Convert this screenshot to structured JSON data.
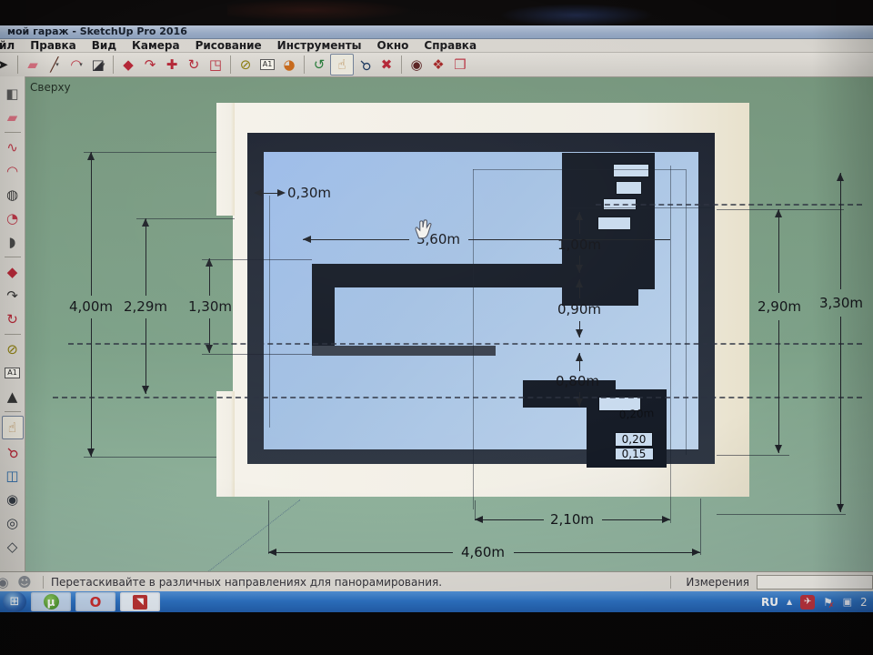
{
  "window": {
    "title": "мой гараж - SketchUp Pro 2016"
  },
  "menu_bar": {
    "items": [
      "Файл",
      "Правка",
      "Вид",
      "Камера",
      "Рисование",
      "Инструменты",
      "Окно",
      "Справка"
    ]
  },
  "toolbar": {
    "tools": [
      {
        "name": "select-tool",
        "glyph": "➤",
        "color": "#1d1d1d"
      },
      {
        "type": "sep"
      },
      {
        "name": "eraser-tool",
        "glyph": "▰",
        "color": "#d96b7d"
      },
      {
        "name": "line-tool",
        "glyph": "╱",
        "color": "#5a2d20",
        "dd": true
      },
      {
        "name": "arc-tool",
        "glyph": "◠",
        "color": "#c03344",
        "dd": true
      },
      {
        "name": "rectangle-tool",
        "glyph": "◪",
        "color": "#2d2d33",
        "dd": true
      },
      {
        "type": "sep"
      },
      {
        "name": "push-pull-tool",
        "glyph": "◆",
        "color": "#bb2233"
      },
      {
        "name": "follow-me-tool",
        "glyph": "↷",
        "color": "#bb2233"
      },
      {
        "name": "move-tool",
        "glyph": "✚",
        "color": "#bb2233"
      },
      {
        "name": "rotate-tool",
        "glyph": "↻",
        "color": "#bb2233"
      },
      {
        "name": "offset-tool",
        "glyph": "◳",
        "color": "#bb2233"
      },
      {
        "type": "sep"
      },
      {
        "name": "tape-measure-tool",
        "glyph": "⊘",
        "color": "#8a7a00"
      },
      {
        "name": "text-tool",
        "glyph": "A1",
        "color": "#222",
        "boxed": true
      },
      {
        "name": "paint-bucket-tool",
        "glyph": "◕",
        "color": "#cc6611"
      },
      {
        "type": "sep"
      },
      {
        "name": "orbit-tool",
        "glyph": "↺",
        "color": "#1e7a33"
      },
      {
        "name": "pan-tool",
        "glyph": "☝",
        "color": "#b8874a",
        "selected": true
      },
      {
        "name": "zoom-tool",
        "glyph": "⚲",
        "color": "#16335e",
        "rot": true
      },
      {
        "name": "zoom-extents-tool",
        "glyph": "✖",
        "color": "#bb2233"
      },
      {
        "type": "sep"
      },
      {
        "name": "position-camera-tool",
        "glyph": "◉",
        "color": "#5a1d1d"
      },
      {
        "name": "walk-tool",
        "glyph": "❖",
        "color": "#aa2222"
      },
      {
        "name": "send-to-layout",
        "glyph": "❒",
        "color": "#c03344"
      }
    ]
  },
  "tool_palette": {
    "tools": [
      {
        "name": "shapes-tool",
        "glyph": "◧",
        "color": "#555"
      },
      {
        "name": "eraser-tool",
        "glyph": "▰",
        "color": "#d96b7d"
      },
      {
        "type": "sep"
      },
      {
        "name": "freehand-tool",
        "glyph": "∿",
        "color": "#c03344"
      },
      {
        "name": "arc-tool",
        "glyph": "◠",
        "color": "#c03344"
      },
      {
        "name": "circle-tool",
        "glyph": "◍",
        "color": "#333"
      },
      {
        "name": "pie-tool",
        "glyph": "◔",
        "color": "#c03344"
      },
      {
        "name": "polygon-tool",
        "glyph": "◗",
        "color": "#444"
      },
      {
        "type": "sep"
      },
      {
        "name": "push-pull-tool",
        "glyph": "◆",
        "color": "#bb2233"
      },
      {
        "name": "follow-me-tool",
        "glyph": "↷",
        "color": "#333"
      },
      {
        "name": "rotate-tool",
        "glyph": "↻",
        "color": "#bb2233"
      },
      {
        "type": "sep"
      },
      {
        "name": "tape-measure-tool",
        "glyph": "⊘",
        "color": "#8a7a00"
      },
      {
        "name": "text-tool",
        "glyph": "A1",
        "color": "#222",
        "boxed": true
      },
      {
        "name": "add-location-tool",
        "glyph": "▲",
        "color": "#333"
      },
      {
        "type": "sep"
      },
      {
        "name": "pan-tool",
        "glyph": "☝",
        "color": "#b8874a",
        "selected": true
      },
      {
        "name": "zoom-tool",
        "glyph": "⚲",
        "color": "#bb2233",
        "rot": true
      },
      {
        "name": "zoom-window-tool",
        "glyph": "◫",
        "color": "#2266aa"
      },
      {
        "name": "orbit-tool",
        "glyph": "◉",
        "color": "#333a44"
      },
      {
        "name": "look-around-tool",
        "glyph": "◎",
        "color": "#333a44"
      },
      {
        "name": "section-plane-tool",
        "glyph": "◇",
        "color": "#333a44"
      }
    ]
  },
  "canvas": {
    "view_label": "Сверху",
    "dimensions": {
      "wall_thickness": "0,30m",
      "pit_length": "3,60m",
      "front_to_pit": "1,00m",
      "pit_width": "0,90m",
      "pit_to_rear": "0,80m",
      "left_outer": "4,00m",
      "left_mid": "2,29m",
      "left_notch": "1,30m",
      "right_inner": "2,90m",
      "right_outer": "3,30m",
      "rear_opening": "2,10m",
      "overall_width": "4,60m",
      "step_rise": "0,20",
      "step_run": "0,15",
      "step_dim": "0,20m"
    }
  },
  "status_bar": {
    "icons": [
      {
        "name": "geolocation-status-icon",
        "glyph": "◉",
        "color": "#767d86",
        "interactable": "false"
      },
      {
        "name": "credits-status-icon",
        "glyph": "☻",
        "color": "#8a8f96",
        "interactable": "false"
      }
    ],
    "hint": "Перетаскивайте в различных направлениях для панорамирования.",
    "measurements_label": "Измерения",
    "measurements_value": ""
  },
  "taskbar": {
    "buttons": [
      {
        "name": "start-button",
        "glyph": "⊞",
        "color": "#ffffff",
        "cls": "start"
      },
      {
        "name": "utorrent-taskbar-button",
        "glyph": "µ",
        "color": "#ffffff",
        "cls": "utorrent"
      },
      {
        "name": "opera-taskbar-button",
        "glyph": "O",
        "color": "#d42b2b",
        "cls": "opera"
      },
      {
        "name": "sketchup-taskbar-button",
        "glyph": "◥",
        "color": "#ffffff",
        "cls": "sketchup"
      }
    ],
    "tray": [
      {
        "name": "language-indicator",
        "glyph": "RU",
        "cls": "lang"
      },
      {
        "name": "show-hidden-icons-chevron",
        "glyph": "▲",
        "cls": "chev"
      },
      {
        "name": "red-app-tray-icon",
        "glyph": "✈",
        "cls": "redapp"
      },
      {
        "name": "action-center-flag-icon",
        "glyph": "⚑",
        "cls": "flag"
      },
      {
        "name": "action-center-x-icon",
        "glyph": "✗",
        "cls": "flagx",
        "interactable": "false"
      },
      {
        "name": "network-tray-icon",
        "glyph": "▣",
        "cls": "net"
      }
    ],
    "language_indicator": "RU",
    "clock_partial": "2"
  }
}
